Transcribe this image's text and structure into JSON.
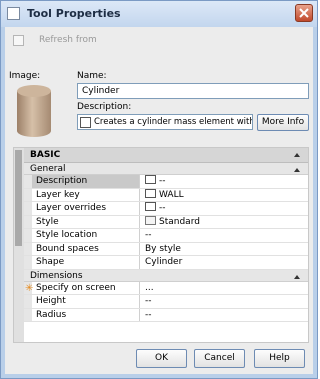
{
  "window": {
    "title": "Tool Properties",
    "close_icon": "close-icon",
    "title_icon": "tool-palette-icon"
  },
  "refresh": {
    "label": "Refresh from",
    "checked": false,
    "enabled": false
  },
  "image": {
    "label": "Image:",
    "icon": "cylinder-icon"
  },
  "name": {
    "label": "Name:",
    "value": "Cylinder"
  },
  "description": {
    "label": "Description:",
    "value": "Creates a cylinder mass element with",
    "icon": "text-editor-icon"
  },
  "more_info_label": "More Info",
  "grid": {
    "section_title": "BASIC",
    "categories": [
      {
        "title": "General",
        "rows": [
          {
            "name": "Description",
            "value": "--",
            "icon": "text-editor-icon",
            "selected": true
          },
          {
            "name": "Layer key",
            "value": "WALL",
            "icon": "layer-key-icon"
          },
          {
            "name": "Layer overrides",
            "value": "--",
            "icon": "layer-overrides-icon"
          },
          {
            "name": "Style",
            "value": "Standard",
            "icon": "style-icon"
          },
          {
            "name": "Style location",
            "value": "--"
          },
          {
            "name": "Bound spaces",
            "value": "By style"
          },
          {
            "name": "Shape",
            "value": "Cylinder"
          }
        ]
      },
      {
        "title": "Dimensions",
        "rows": [
          {
            "name": "Specify on screen",
            "value": "...",
            "marker": "✳"
          },
          {
            "name": "Height",
            "value": "--"
          },
          {
            "name": "Radius",
            "value": "--"
          }
        ]
      }
    ]
  },
  "buttons": {
    "ok": "OK",
    "cancel": "Cancel",
    "help": "Help"
  }
}
